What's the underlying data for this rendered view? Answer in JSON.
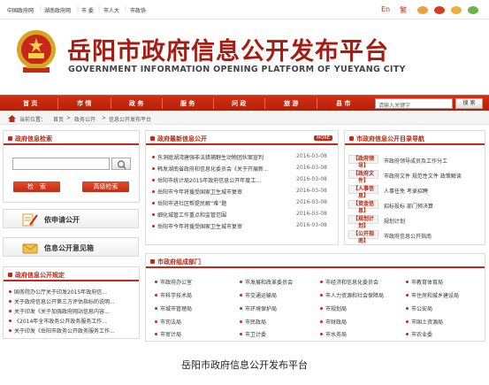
{
  "topbar": {
    "links": [
      "中国政府网",
      "湖南政府网",
      "市 委",
      "市人大",
      "市政协"
    ],
    "lang": [
      "En",
      "繁"
    ]
  },
  "header": {
    "title": "岳阳市政府信息公开发布平台",
    "subtitle": "GOVERNMENT INFORMATION OPENING PLATFORM OF YUEYANG CITY"
  },
  "nav": {
    "items": [
      "首 页",
      "市 情",
      "政 务",
      "服 务",
      "问 政",
      "旅 游",
      "县 市"
    ],
    "search_placeholder": "请输入关键字",
    "search_button": "搜 索"
  },
  "breadcrumb": {
    "label": "当前位置：",
    "items": [
      "首页",
      "政务公开",
      "信息公开发布平台"
    ]
  },
  "left": {
    "search_title": "政府信息检索",
    "search_btn": "检　索",
    "adv_btn": "高级检索",
    "apply_label": "依申请公开",
    "feedback_label": "信息公开意见箱",
    "rules_title": "政府信息公开规定",
    "rules": [
      "国务院办公厅关于印发2015年政府信...",
      "关于政府信息公开第三方评估指标的说明...",
      "关于印发《关于加强政府网站信息内容...",
      "《2014年全市政务公开政务服务工作...",
      "关于印发《岳阳市政务公开政务服务工作..."
    ]
  },
  "latest": {
    "title": "政府最新信息公开",
    "more": "MORE",
    "items": [
      {
        "t": "东洞庭湖湾建强非法猎捕野生动物团伙案宣判",
        "d": "2016-03-08"
      },
      {
        "t": "韩发湖南省政府和信息化委员会《关于开展新...",
        "d": "2016-03-08"
      },
      {
        "t": "岳阳市统计局2015年政府信息公开年度工...",
        "d": "2016-03-08"
      },
      {
        "t": "岳阳市今年将援受国家卫生城市复审",
        "d": "2016-03-08"
      },
      {
        "t": "岳阳市进社区帮提民解“难”题",
        "d": "2016-03-08"
      },
      {
        "t": "细化城管工作重点和监管范围",
        "d": "2016-03-08"
      },
      {
        "t": "岳阳市今年将援受国家卫生城市复审",
        "d": "2016-03-08"
      }
    ]
  },
  "catalog": {
    "title": "市政府信息公开目录导航",
    "rows": [
      {
        "tag": "【政府领导】",
        "text": "市政府领导成员及工作分工"
      },
      {
        "tag": "【政府文件】",
        "text": "市政府文件  规范性文件  政策解读"
      },
      {
        "tag": "【人事信息】",
        "text": "人事任免  考录招聘"
      },
      {
        "tag": "【资金信息】",
        "text": "招标投标  部门预决算"
      },
      {
        "tag": "【规划计划】",
        "text": "规划计划"
      },
      {
        "tag": "【公开指南】",
        "text": "市政府信息公开指南"
      }
    ]
  },
  "depts": {
    "title": "市政府组成部门",
    "items": [
      "市政府办公室",
      "市发展和改革委员会",
      "市经济和信息化委员会",
      "市教育体育局",
      "市科学技术局",
      "市交通运输局",
      "市人力资源和社会保障局",
      "市住房和城乡建设局",
      "市城市管理局",
      "市环境保护局",
      "市规划局",
      "市公安局",
      "市司法局",
      "市民政局",
      "市财政局",
      "市国土资源局",
      "市审计局",
      "市卫计委",
      "市水务局",
      "市农业委"
    ]
  },
  "caption": "岳阳市政府信息公开发布平台",
  "colors": {
    "accent": "#c9261a",
    "nav": "#c42a10",
    "title": "#a71c12"
  }
}
